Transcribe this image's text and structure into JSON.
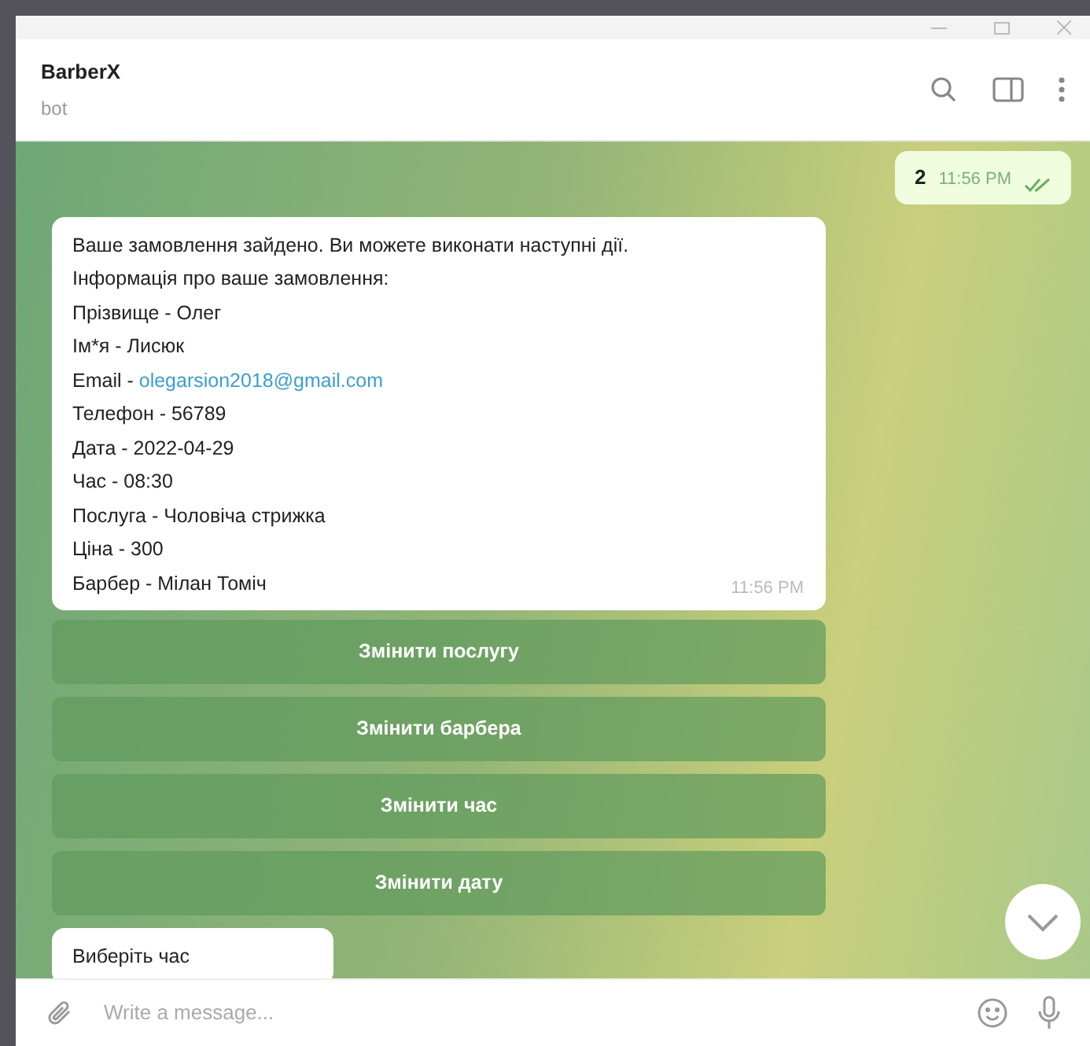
{
  "header": {
    "title": "BarberX",
    "subtitle": "bot"
  },
  "messages": [
    {
      "kind": "outgoing",
      "text": "2",
      "time": "11:56 PM",
      "read": true
    },
    {
      "kind": "incoming",
      "lines": [
        {
          "text": "Ваше замовлення зайдено. Ви можете виконати наступні дії."
        },
        {
          "text": "Інформація про ваше замовлення:"
        },
        {
          "text": "Прізвище - Олег"
        },
        {
          "text": "Ім*я - Лисюк"
        },
        {
          "text": "Email - ",
          "link": "olegarsion2018@gmail.com"
        },
        {
          "text": "Телефон - 56789"
        },
        {
          "text": "Дата - 2022-04-29"
        },
        {
          "text": "Час - 08:30"
        },
        {
          "text": "Послуга - Чоловіча стрижка"
        },
        {
          "text": "Ціна - 300"
        },
        {
          "text": "Барбер - Мілан Томіч"
        }
      ],
      "time": "11:56 PM"
    },
    {
      "kind": "keyboard",
      "buttons": [
        "Змінити послугу",
        "Змінити барбера",
        "Змінити час",
        "Змінити дату"
      ]
    },
    {
      "kind": "incoming",
      "lines": [
        {
          "text": "Виберіть час"
        }
      ]
    }
  ],
  "composer": {
    "placeholder": "Write a message..."
  }
}
